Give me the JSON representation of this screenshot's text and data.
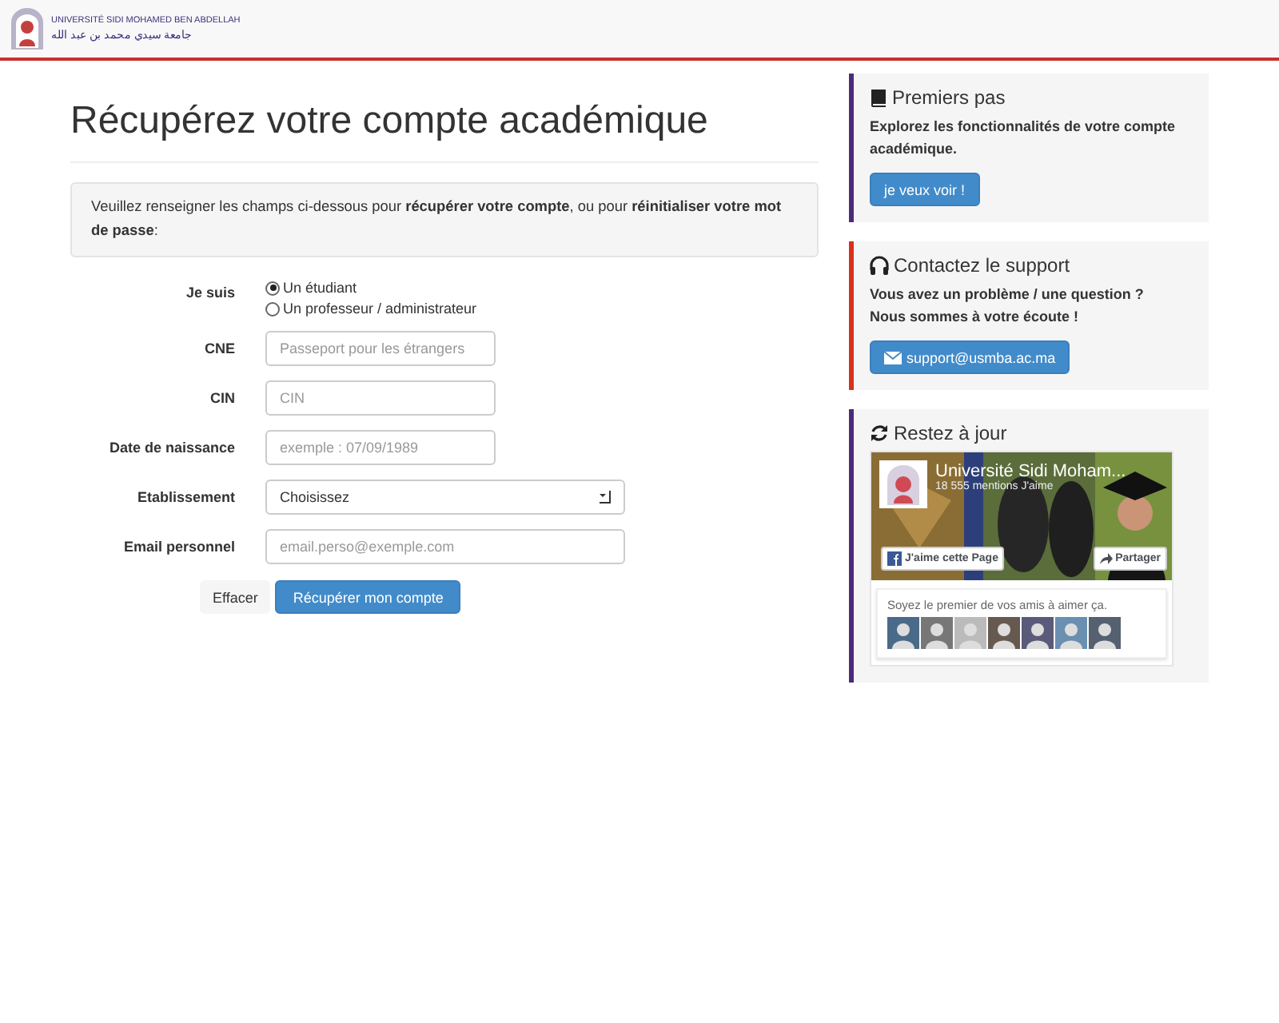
{
  "header": {
    "logo_latin": "UNIVERSITÉ SIDI MOHAMED BEN ABDELLAH",
    "logo_arabic": "جامعة سيدي محمد بن عبد الله"
  },
  "title": "Récupérez votre compte académique",
  "notice": "Veuillez renseigner les champs ci-dessous pour **récupérer votre compte**, ou pour **réinitialiser votre mot de passe**:",
  "form": {
    "role_label": "Je suis",
    "roles": [
      {
        "label": "Un étudiant",
        "selected": true
      },
      {
        "label": "Un professeur / administrateur",
        "selected": false
      }
    ],
    "fields": [
      {
        "kind": "text",
        "label": "CNE",
        "placeholder": "Passeport pour les étrangers"
      },
      {
        "kind": "text",
        "label": "CIN",
        "placeholder": "CIN"
      },
      {
        "kind": "text",
        "label": "Date de naissance",
        "placeholder": "exemple : 07/09/1989"
      },
      {
        "kind": "select",
        "label": "Etablissement",
        "value": "Choisissez"
      },
      {
        "kind": "wide",
        "label": "Email personnel",
        "placeholder": "email.perso@exemple.com"
      }
    ],
    "buttons": [
      {
        "kind": "default",
        "label": "Effacer"
      },
      {
        "kind": "primary",
        "label": "Récupérer mon compte"
      }
    ]
  },
  "sidebar": [
    {
      "kind": "book",
      "color": "#4b2a7b",
      "title": "Premiers pas",
      "text": "Explorez les fonctionnalités de votre compte académique.",
      "button": "je veux voir !"
    },
    {
      "kind": "headphones",
      "color": "#d9301c",
      "title": "Contactez le support",
      "text": "Vous avez un problème / une question ?\nNous sommes à votre écoute !",
      "button": "support@usmba.ac.ma"
    },
    {
      "kind": "refresh",
      "color": "#4b2a7b",
      "title": "Restez à jour",
      "widget": {
        "page_name": "Université Sidi Moham...",
        "likes": "18 555 mentions J'aime",
        "like_button": "J'aime cette Page",
        "share_button": "Partager",
        "friends_text": "Soyez le premier de vos amis à aimer ça."
      }
    }
  ]
}
